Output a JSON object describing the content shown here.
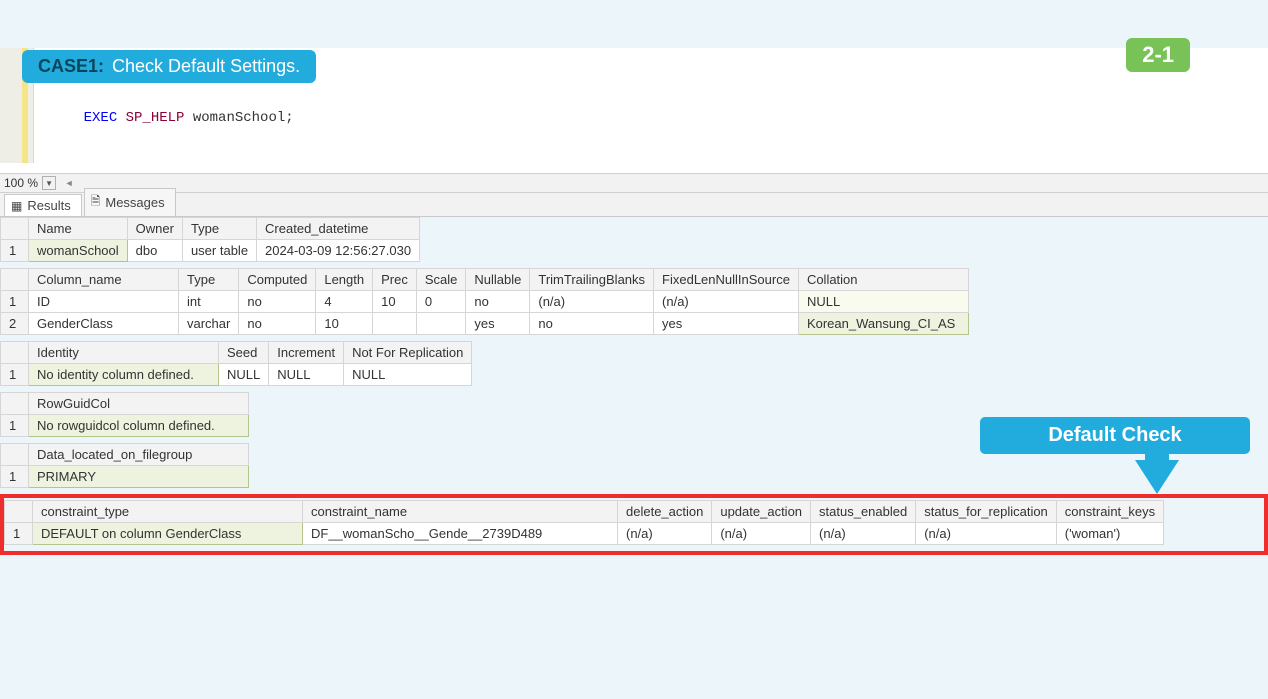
{
  "banner": {
    "case": "CASE1:",
    "text": "Check Default Settings."
  },
  "slide_badge": "2-1",
  "sql": {
    "exec": "EXEC",
    "sp": "SP_HELP",
    "obj": "womanSchool",
    "semi": ";"
  },
  "zoom": {
    "pct": "100 %"
  },
  "tabs": {
    "results": "Results",
    "messages": "Messages"
  },
  "grid_object": {
    "headers": [
      "Name",
      "Owner",
      "Type",
      "Created_datetime"
    ],
    "rows": [
      {
        "n": "1",
        "cells": [
          "womanSchool",
          "dbo",
          "user table",
          "2024-03-09 12:56:27.030"
        ]
      }
    ]
  },
  "grid_columns": {
    "headers": [
      "Column_name",
      "Type",
      "Computed",
      "Length",
      "Prec",
      "Scale",
      "Nullable",
      "TrimTrailingBlanks",
      "FixedLenNullInSource",
      "Collation"
    ],
    "rows": [
      {
        "n": "1",
        "cells": [
          "ID",
          "int",
          "no",
          "4",
          "10",
          "0",
          "no",
          "(n/a)",
          "(n/a)",
          "NULL"
        ]
      },
      {
        "n": "2",
        "cells": [
          "GenderClass",
          "varchar",
          "no",
          "10",
          "",
          "",
          "yes",
          "no",
          "yes",
          "Korean_Wansung_CI_AS"
        ]
      }
    ]
  },
  "grid_identity": {
    "headers": [
      "Identity",
      "Seed",
      "Increment",
      "Not For Replication"
    ],
    "rows": [
      {
        "n": "1",
        "cells": [
          "No identity column defined.",
          "NULL",
          "NULL",
          "NULL"
        ]
      }
    ]
  },
  "grid_rowguid": {
    "headers": [
      "RowGuidCol"
    ],
    "rows": [
      {
        "n": "1",
        "cells": [
          "No rowguidcol column defined."
        ]
      }
    ]
  },
  "grid_filegroup": {
    "headers": [
      "Data_located_on_filegroup"
    ],
    "rows": [
      {
        "n": "1",
        "cells": [
          "PRIMARY"
        ]
      }
    ]
  },
  "grid_constraint": {
    "headers": [
      "constraint_type",
      "constraint_name",
      "delete_action",
      "update_action",
      "status_enabled",
      "status_for_replication",
      "constraint_keys"
    ],
    "rows": [
      {
        "n": "1",
        "cells": [
          "DEFAULT on column GenderClass",
          "DF__womanScho__Gende__2739D489",
          "(n/a)",
          "(n/a)",
          "(n/a)",
          "(n/a)",
          "('woman')"
        ]
      }
    ]
  },
  "callout": "Default Check"
}
